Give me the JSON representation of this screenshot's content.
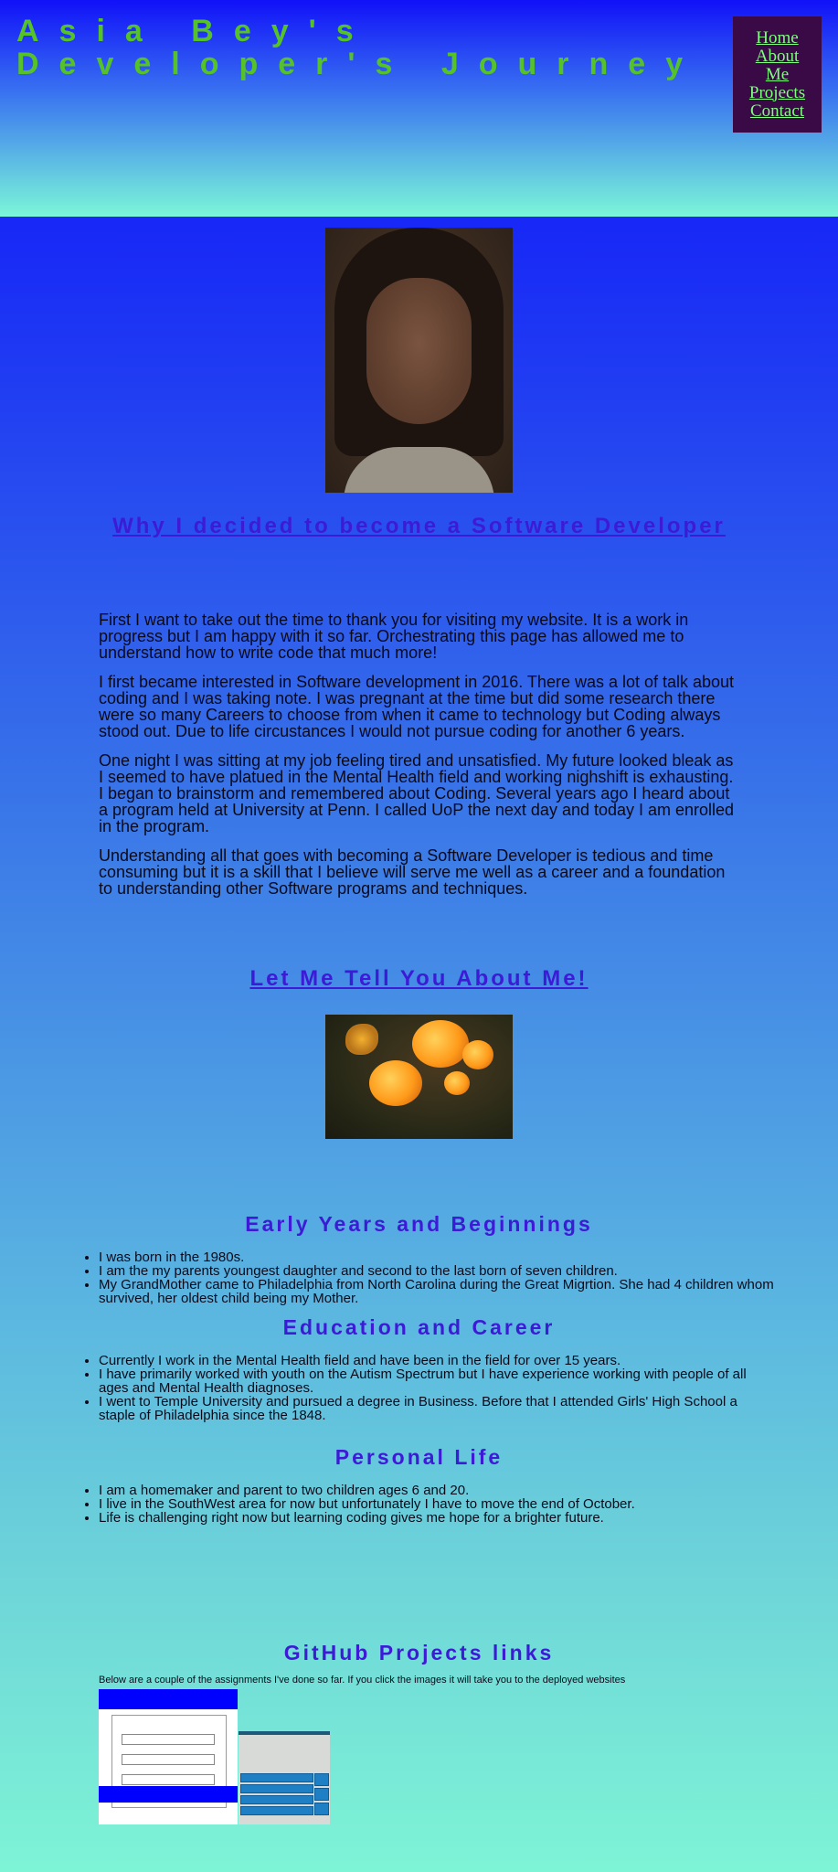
{
  "header": {
    "title": "Asia Bey's Developer's Journey",
    "nav": [
      "Home",
      "About Me",
      "Projects",
      "Contact"
    ]
  },
  "images": {
    "portrait": "portrait-photo",
    "flowers": "butterfly-flower-photo"
  },
  "why_section": {
    "heading": "Why I decided to become a Software Developer",
    "paragraphs": [
      "First I want to take out the time to thank you for visiting my website. It is a work in progress but I am happy with it so far. Orchestrating this page has allowed me to understand how to write code that much more!",
      "I first became interested in Software development in 2016. There was a lot of talk about coding and I was taking note. I was pregnant at the time but did some research there were so many Careers to choose from when it came to technology but Coding always stood out. Due to life circustances I would not pursue coding for another 6 years.",
      "One night I was sitting at my job feeling tired and unsatisfied. My future looked bleak as I seemed to have platued in the Mental Health field and working nighshift is exhausting. I began to brainstorm and remembered about Coding. Several years ago I heard about a program held at University at Penn. I called UoP the next day and today I am enrolled in the program.",
      "Understanding all that goes with becoming a Software Developer is tedious and time consuming but it is a skill that I believe will serve me well as a career and a foundation to understanding other Software programs and techniques."
    ]
  },
  "about_section": {
    "heading": "Let Me Tell You About Me!"
  },
  "early_years": {
    "heading": "Early Years and Beginnings",
    "items": [
      "I was born in the 1980s.",
      "I am the my parents youngest daughter and second to the last born of seven children.",
      "My GrandMother came to Philadelphia from North Carolina during the Great Migrtion. She had 4 children whom survived, her oldest child being my Mother."
    ]
  },
  "education": {
    "heading": "Education and Career",
    "items": [
      "Currently I work in the Mental Health field and have been in the field for over 15 years.",
      "I have primarily worked with youth on the Autism Spectrum but I have experience working with people of all ages and Mental Health diagnoses.",
      "I went to Temple University and pursued a degree in Business. Before that I attended Girls' High School a staple of Philadelphia since the 1848."
    ]
  },
  "personal": {
    "heading": "Personal Life",
    "items": [
      "I am a homemaker and parent to two children ages 6 and 20.",
      "I live in the SouthWest area for now but unfortunately I have to move the end of October.",
      "Life is challenging right now but learning coding gives me hope for a brighter future."
    ]
  },
  "github": {
    "heading": "GitHub Projects links",
    "intro": "Below are a couple of the assignments I've done so far. If you click the images it will take you to the deployed websites",
    "projects": [
      "project-thumbnail-1",
      "project-thumbnail-2"
    ]
  },
  "colors": {
    "title": "#55c22a",
    "nav_bg": "#3a0a46",
    "nav_link": "#7dff7d",
    "heading": "#3d1bd6"
  }
}
